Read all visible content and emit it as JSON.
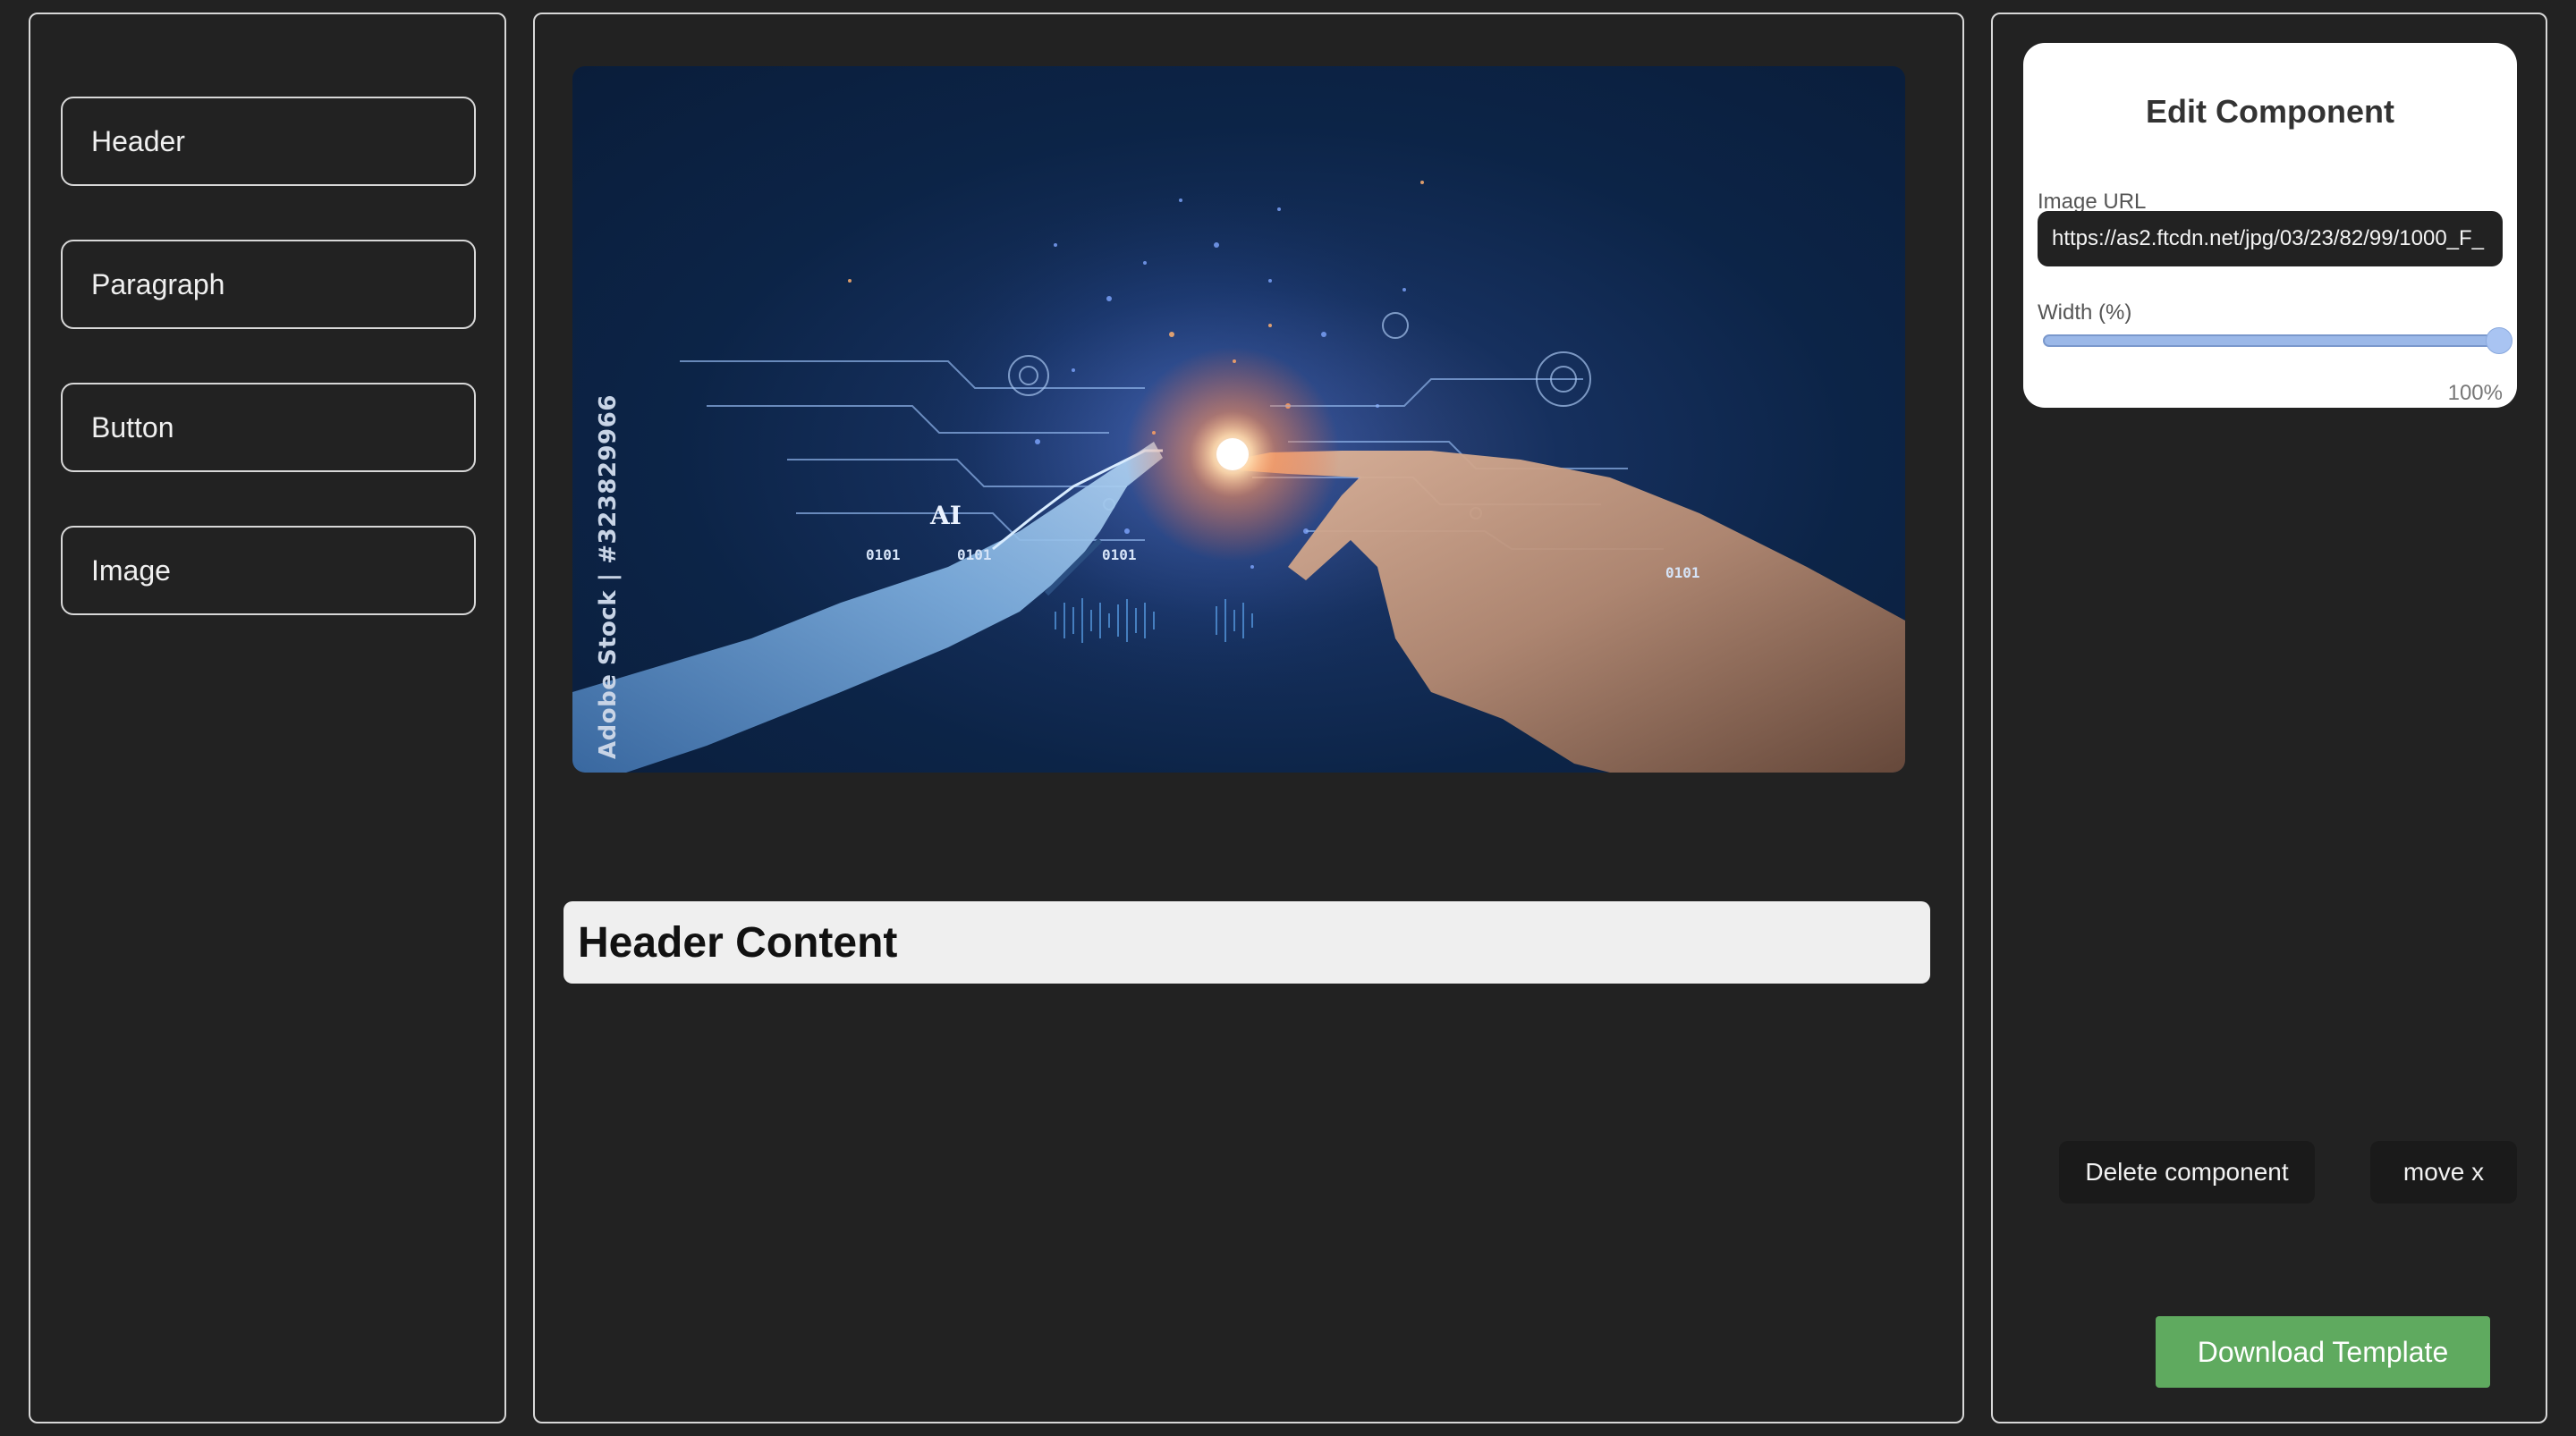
{
  "palette": {
    "items": [
      {
        "label": "Header"
      },
      {
        "label": "Paragraph"
      },
      {
        "label": "Button"
      },
      {
        "label": "Image"
      }
    ]
  },
  "canvas": {
    "image": {
      "watermark": "Adobe Stock | #323829966",
      "overlay_text_ai": "AI",
      "binary_labels": [
        "0101",
        "0101",
        "0101",
        "0101"
      ]
    },
    "header_text": "Header Content"
  },
  "editor": {
    "title": "Edit Component",
    "image_url_label": "Image URL",
    "image_url_value": "https://as2.ftcdn.net/jpg/03/23/82/99/1000_F_",
    "width_label": "Width (%)",
    "width_value": 100,
    "width_display": "100%"
  },
  "actions": {
    "delete_label": "Delete component",
    "move_label": "move x",
    "download_label": "Download Template"
  },
  "colors": {
    "background": "#222222",
    "download_button": "#5faa5f",
    "slider": "#9bb8e8"
  }
}
